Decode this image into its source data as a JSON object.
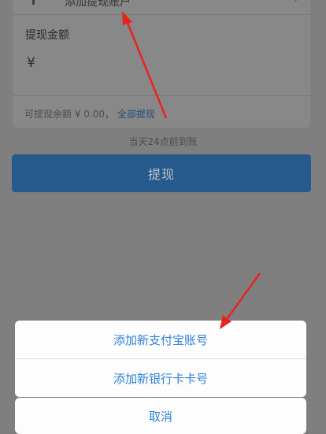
{
  "form": {
    "account_placeholder": "添加提现账户",
    "amount_label": "提现金额",
    "currency_symbol": "¥",
    "balance_prefix": "可提现余额 ¥ 0.00，",
    "withdraw_all": "全部提现",
    "arrival_note": "当天24点前到账",
    "submit_label": "提现"
  },
  "action_sheet": {
    "items": [
      {
        "label": "添加新支付宝账号"
      },
      {
        "label": "添加新银行卡卡号"
      }
    ],
    "cancel_label": "取消"
  },
  "annotation_color": "#e8231f"
}
